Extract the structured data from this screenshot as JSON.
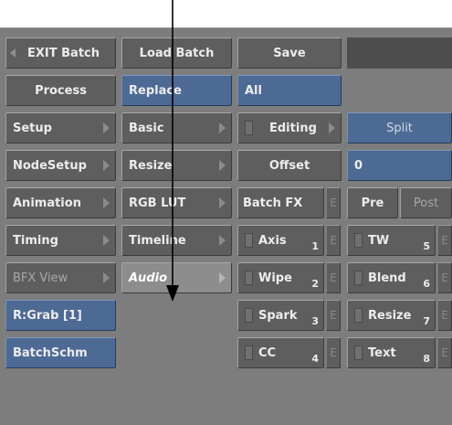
{
  "col1": {
    "exit_batch": "EXIT Batch",
    "process": "Process",
    "setup": "Setup",
    "nodesetup": "NodeSetup",
    "animation": "Animation",
    "timing": "Timing",
    "bfx_view": "BFX View",
    "rgrab": "R:Grab [1]",
    "batchschm": "BatchSchm"
  },
  "col2": {
    "load_batch": "Load Batch",
    "replace": "Replace",
    "basic": "Basic",
    "resize": "Resize",
    "rgb_lut": "RGB LUT",
    "timeline": "Timeline",
    "audio": "Audio"
  },
  "col3": {
    "save": "Save",
    "all": "All",
    "editing": "Editing",
    "offset": "Offset",
    "batch_fx": "Batch FX",
    "axis": "Axis",
    "axis_num": "1",
    "wipe": "Wipe",
    "wipe_num": "2",
    "spark": "Spark",
    "spark_num": "3",
    "cc": "CC",
    "cc_num": "4",
    "e_label": "E"
  },
  "col4": {
    "split": "Split",
    "offset_value": "0",
    "pre": "Pre",
    "post": "Post",
    "tw": "TW",
    "tw_num": "5",
    "blend": "Blend",
    "blend_num": "6",
    "resize": "Resize",
    "resize_num": "7",
    "text": "Text",
    "text_num": "8",
    "e_label": "E"
  },
  "colors": {
    "panel": "#7d7d7d",
    "button_gray": "#5e5e5e",
    "button_blue": "#4d6a95",
    "text": "#ececec"
  }
}
